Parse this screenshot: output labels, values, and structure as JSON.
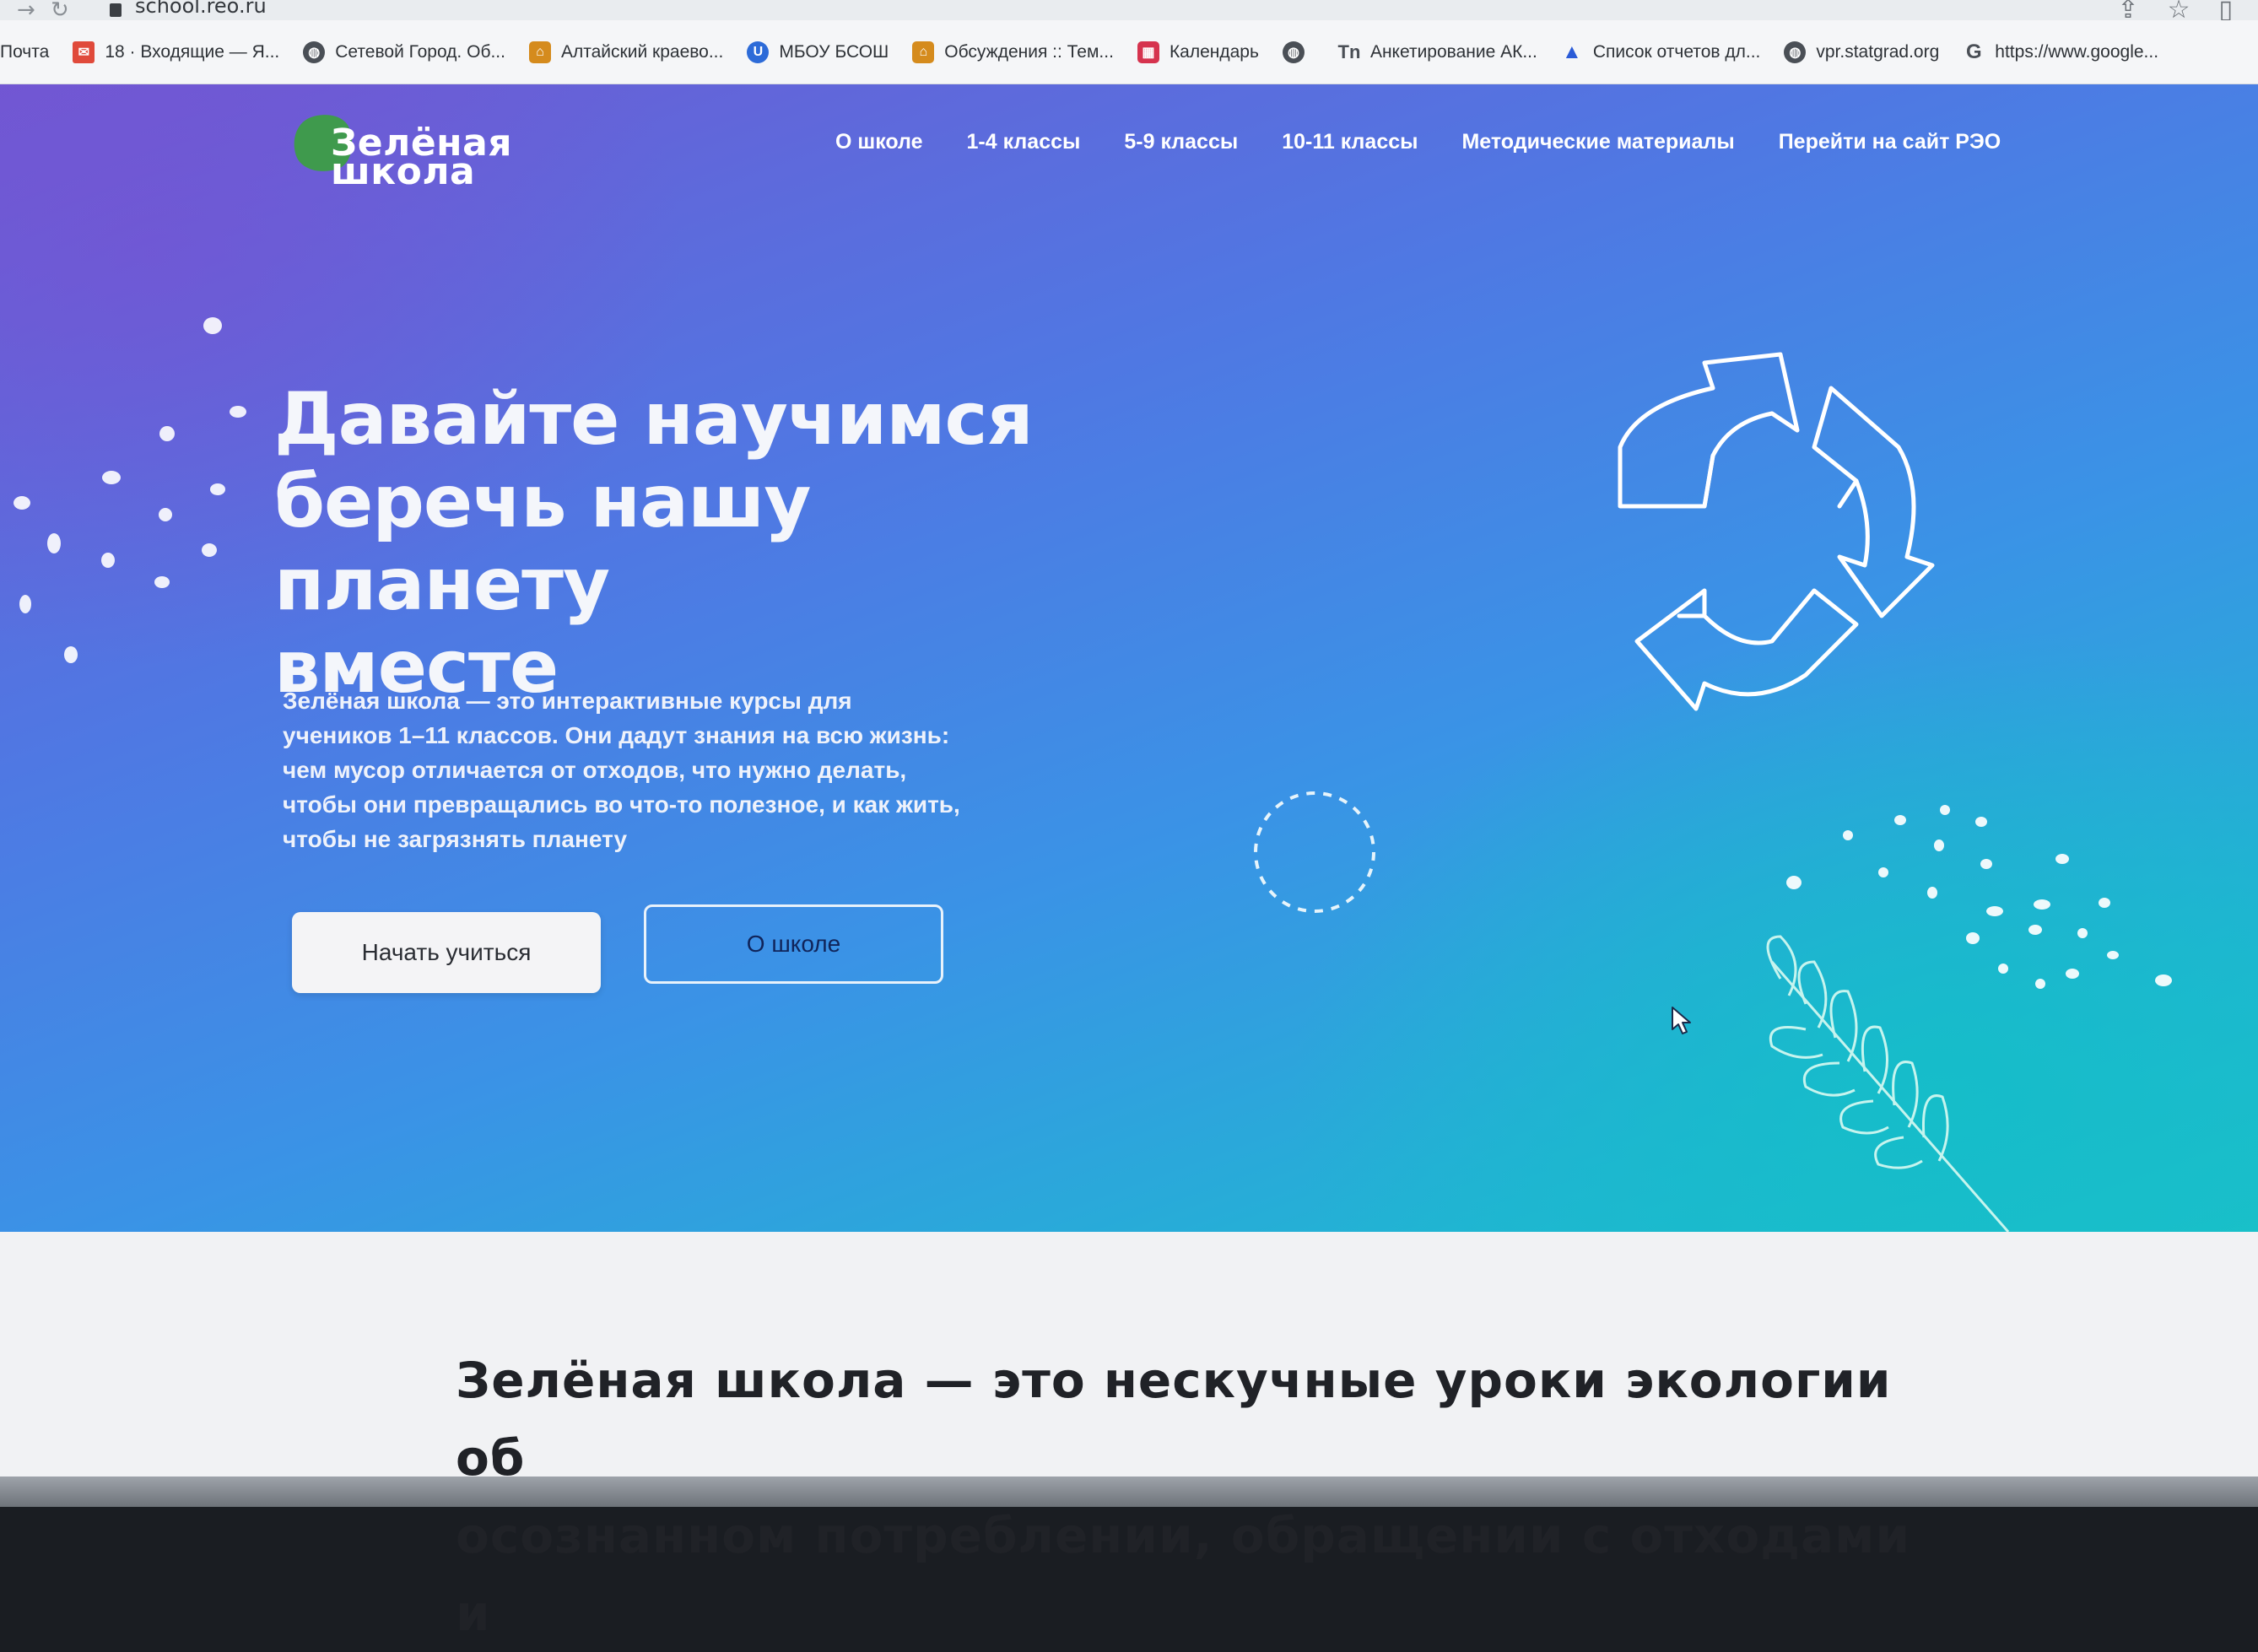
{
  "browser": {
    "url": "school.reo.ru",
    "bookmarks": [
      {
        "label": "Почта",
        "icon": "mail-text",
        "color": ""
      },
      {
        "label": "18 · Входящие — Я...",
        "icon": "envelope-icon",
        "color": "#e04a3b"
      },
      {
        "label": "Сетевой Город. Об...",
        "icon": "globe-icon",
        "color": "#4a4f56"
      },
      {
        "label": "Алтайский краево...",
        "icon": "house-icon",
        "color": "#d58b1d"
      },
      {
        "label": "МБОУ БСОШ",
        "icon": "u-badge-icon",
        "color": "#2d6bd8"
      },
      {
        "label": "Обсуждения :: Тем...",
        "icon": "house-icon",
        "color": "#d58b1d"
      },
      {
        "label": "Календарь",
        "icon": "calendar-icon",
        "color": "#d6334e"
      },
      {
        "label": "",
        "icon": "globe-icon",
        "color": "#4a4f56"
      },
      {
        "label": "Анкетирование АК...",
        "icon": "tn-logo-icon",
        "color": "#4a4f56"
      },
      {
        "label": "Список отчетов дл...",
        "icon": "triangle-icon",
        "color": "#2a5bd7"
      },
      {
        "label": "vpr.statgrad.org",
        "icon": "globe-icon",
        "color": "#4a4f56"
      },
      {
        "label": "https://www.google...",
        "icon": "google-icon",
        "color": "#4a4f56"
      }
    ]
  },
  "site": {
    "logo": {
      "line1": "Зелёная",
      "line2": "школа"
    },
    "nav": [
      "О школе",
      "1-4 классы",
      "5-9 классы",
      "10-11 классы",
      "Методические материалы",
      "Перейти на сайт РЭО"
    ],
    "hero": {
      "title_lines": [
        "Давайте научимся",
        "беречь нашу планету",
        "вместе"
      ],
      "description_lines": [
        "Зелёная школа — это интерактивные курсы для",
        "учеников 1–11 классов. Они дадут знания на всю жизнь:",
        "чем мусор отличается от отходов, что нужно делать,",
        "чтобы они превращались во что-то полезное, и как жить,",
        "чтобы не загрязнять планету"
      ],
      "primary_button": "Начать учиться",
      "secondary_button": "О школе"
    },
    "intro": {
      "lines": [
        "Зелёная школа — это нескучные уроки экологии об",
        "осознанном потреблении, обращении с отходами и"
      ]
    }
  },
  "colors": {
    "logo_green": "#3f9a4d",
    "hero_top": "#6f59d3",
    "hero_bottom": "#1cc1c9",
    "secondary_button_text": "#10245a"
  }
}
